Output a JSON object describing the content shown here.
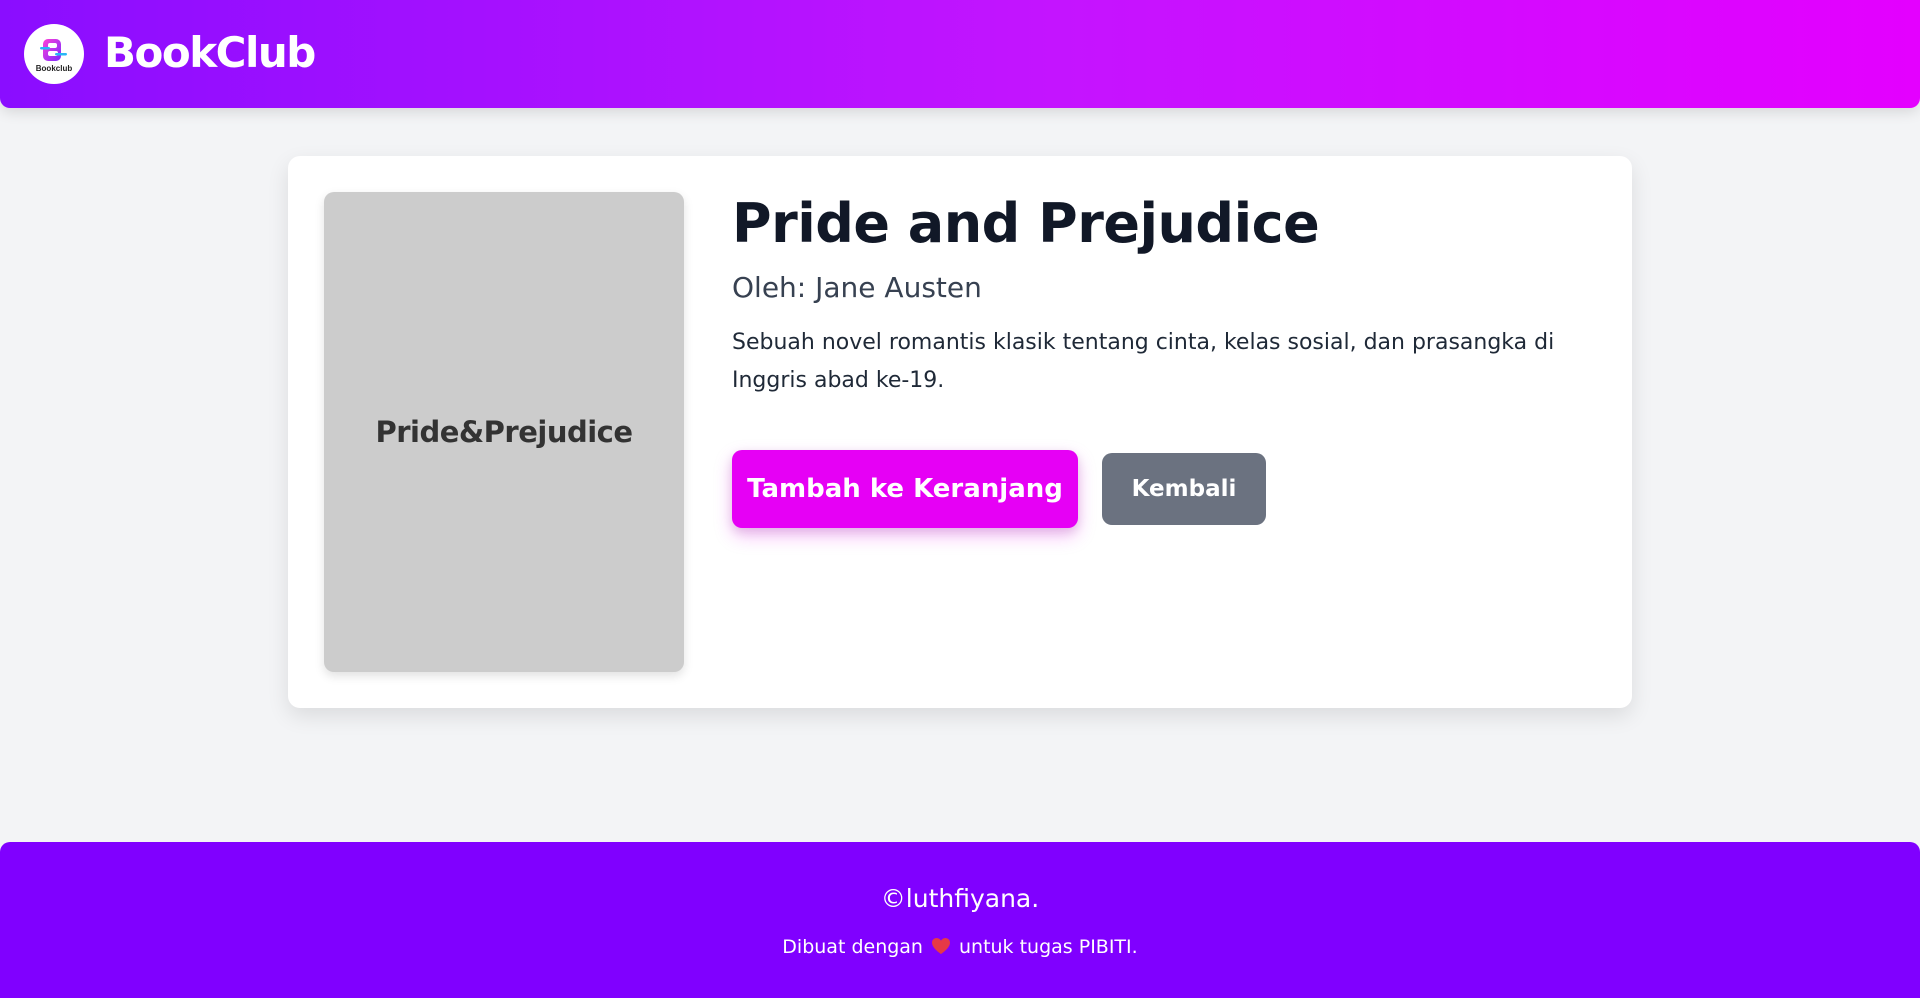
{
  "header": {
    "logo_caption": "Bookclub",
    "brand": "BookClub"
  },
  "book": {
    "cover_text": "Pride&Prejudice",
    "title": "Pride and Prejudice",
    "author": "Oleh: Jane Austen",
    "description": "Sebuah novel romantis klasik tentang cinta, kelas sosial, dan prasangka di Inggris abad ke-19."
  },
  "actions": {
    "add_to_cart_label": "Tambah ke Keranjang",
    "back_label": "Kembali"
  },
  "footer": {
    "copyright": "©luthfiyana.",
    "made_with_prefix": "Dibuat dengan",
    "made_with_suffix": "untuk tugas PIBITI."
  },
  "icons": {
    "logo": "bookclub-logo-icon",
    "heart": "heart-icon"
  },
  "colors": {
    "header_gradient_start": "#8a0dff",
    "header_gradient_end": "#e400ff",
    "primary_button": "#e600f5",
    "secondary_button": "#6b7280",
    "footer_bg": "#8000ff",
    "heart": "#e63946"
  }
}
